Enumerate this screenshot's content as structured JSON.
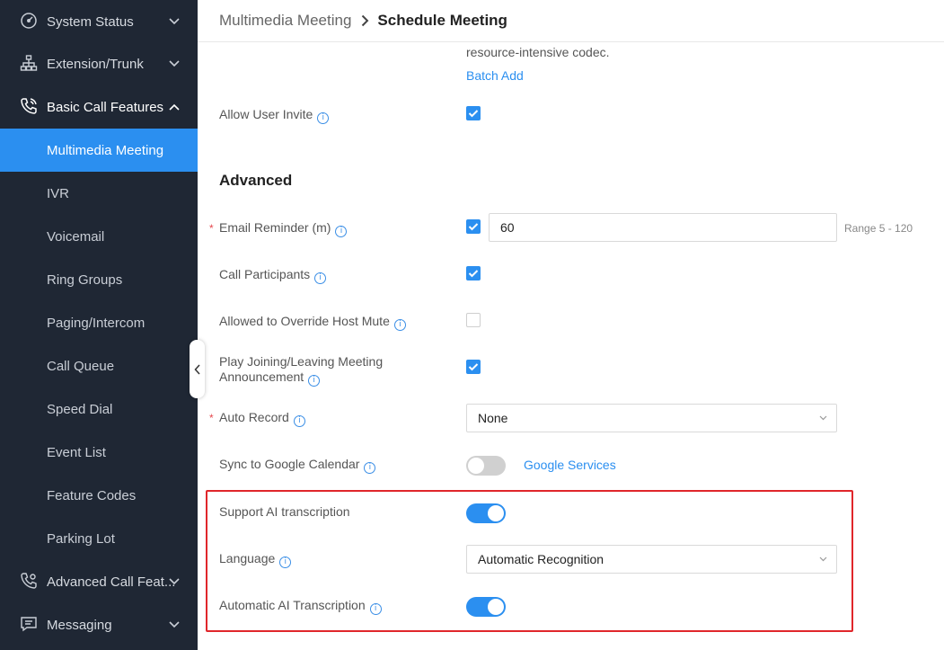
{
  "sidebar": {
    "items": [
      {
        "label": "System Status",
        "icon": "gauge-icon",
        "expanded": false
      },
      {
        "label": "Extension/Trunk",
        "icon": "org-chart-icon",
        "expanded": false
      },
      {
        "label": "Basic Call Features",
        "icon": "phone-call-icon",
        "expanded": true
      },
      {
        "label": "Advanced Call Feat...",
        "icon": "phone-settings-icon",
        "expanded": false
      },
      {
        "label": "Messaging",
        "icon": "message-icon",
        "expanded": false
      }
    ],
    "subitems": [
      {
        "label": "Multimedia Meeting",
        "active": true
      },
      {
        "label": "IVR"
      },
      {
        "label": "Voicemail"
      },
      {
        "label": "Ring Groups"
      },
      {
        "label": "Paging/Intercom"
      },
      {
        "label": "Call Queue"
      },
      {
        "label": "Speed Dial"
      },
      {
        "label": "Event List"
      },
      {
        "label": "Feature Codes"
      },
      {
        "label": "Parking Lot"
      }
    ]
  },
  "breadcrumb": {
    "parent": "Multimedia Meeting",
    "current": "Schedule Meeting"
  },
  "form": {
    "codec_note": "resource-intensive codec.",
    "batch_add": "Batch Add",
    "allow_user_invite": {
      "label": "Allow User Invite",
      "checked": true
    },
    "section_advanced": "Advanced",
    "email_reminder": {
      "label": "Email Reminder (m)",
      "checked": true,
      "value": "60",
      "range": "Range 5 - 120",
      "required": true
    },
    "call_participants": {
      "label": "Call Participants",
      "checked": true
    },
    "override_host_mute": {
      "label": "Allowed to Override Host Mute",
      "checked": false
    },
    "play_announcement": {
      "label_line1": "Play Joining/Leaving Meeting",
      "label_line2": "Announcement",
      "checked": true
    },
    "auto_record": {
      "label": "Auto Record",
      "value": "None",
      "required": true
    },
    "sync_google": {
      "label": "Sync to Google Calendar",
      "enabled": false,
      "link": "Google Services"
    },
    "support_ai": {
      "label": "Support AI transcription",
      "enabled": true
    },
    "language": {
      "label": "Language",
      "value": "Automatic Recognition"
    },
    "auto_ai": {
      "label": "Automatic AI Transcription",
      "enabled": true
    }
  },
  "colors": {
    "sidebar_bg": "#1f2734",
    "accent": "#2b8ff0",
    "highlight": "#e0262b"
  }
}
